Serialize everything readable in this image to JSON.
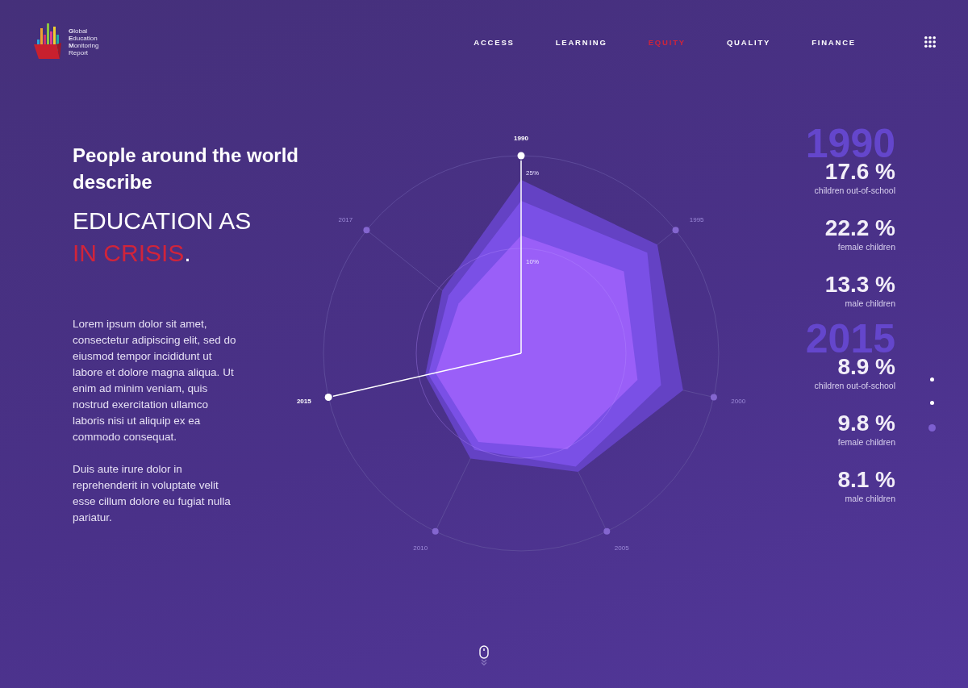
{
  "logo": {
    "lines": [
      "**G**lobal",
      "**E**ducation",
      "**M**onitoring",
      "Report"
    ]
  },
  "nav": [
    {
      "label": "ACCESS",
      "selected": false
    },
    {
      "label": "LEARNING",
      "selected": false
    },
    {
      "label": "EQUITY",
      "selected": true
    },
    {
      "label": "QUALITY",
      "selected": false
    },
    {
      "label": "FINANCE",
      "selected": false
    }
  ],
  "intro": {
    "heading": "People around the world describe",
    "crisis": {
      "lead": "EDUCATION AS",
      "highlight": "IN CRISIS",
      "end": "."
    },
    "paragraphs": [
      "Lorem ipsum dolor sit amet, consectetur adipiscing elit, sed do eiusmod tempor incididunt ut labore et dolore magna aliqua. Ut enim ad minim veniam, quis nostrud exercitation ullamco laboris nisi ut aliquip ex ea commodo consequat.",
      "Duis aute irure dolor in reprehenderit in voluptate velit esse cillum dolore eu fugiat nulla pariatur."
    ]
  },
  "radar": {
    "axes": [
      {
        "label": "1990",
        "selected": true
      },
      {
        "label": "1995",
        "selected": false
      },
      {
        "label": "2000",
        "selected": false
      },
      {
        "label": "2005",
        "selected": false
      },
      {
        "label": "2010",
        "selected": false
      },
      {
        "label": "2015",
        "selected": true
      },
      {
        "label": "2017",
        "selected": false
      }
    ],
    "ticks": [
      "25%",
      "10%"
    ]
  },
  "stat_groups": [
    {
      "year": "1990",
      "stats": [
        {
          "value": "17.6 %",
          "label": "children out-of-school"
        },
        {
          "value": "22.2 %",
          "label": "female children"
        },
        {
          "value": "13.3 %",
          "label": "male children"
        }
      ]
    },
    {
      "year": "2015",
      "stats": [
        {
          "value": "8.9 %",
          "label": "children out-of-school"
        },
        {
          "value": "9.8 %",
          "label": "female children"
        },
        {
          "value": "8.1 %",
          "label": "male children"
        }
      ]
    }
  ],
  "page_dots": [
    {
      "selected": false
    },
    {
      "selected": false
    },
    {
      "selected": true
    }
  ]
}
